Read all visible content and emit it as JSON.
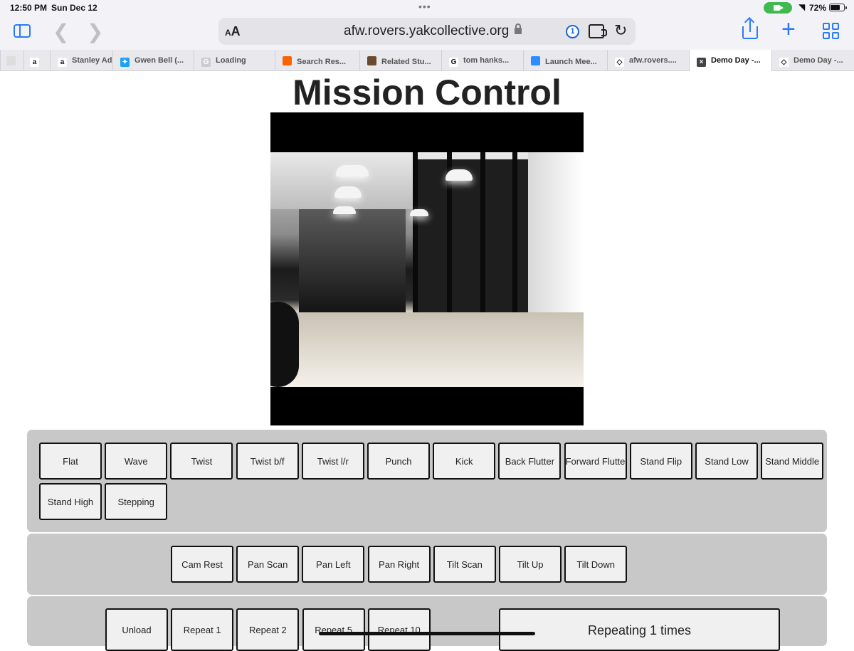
{
  "status_bar": {
    "time": "12:50 PM",
    "date": "Sun Dec 12",
    "battery": "72%",
    "battery_level": 0.72
  },
  "toolbar": {
    "text_size_label": "AA",
    "url": "afw.rovers.yakcollective.org"
  },
  "tabs": [
    {
      "label": "",
      "icon": "page-icon"
    },
    {
      "label": "",
      "icon": "amazon-icon"
    },
    {
      "label": "Stanley Ad",
      "icon": "amazon-icon"
    },
    {
      "label": "Gwen Bell (...",
      "icon": "twitter-icon"
    },
    {
      "label": "Loading",
      "icon": "g-icon"
    },
    {
      "label": "Search Res...",
      "icon": "home-depot-icon"
    },
    {
      "label": "Related Stu...",
      "icon": "book-icon"
    },
    {
      "label": "tom hanks...",
      "icon": "google-icon"
    },
    {
      "label": "Launch Mee...",
      "icon": "zoom-icon"
    },
    {
      "label": "afw.rovers....",
      "icon": "yak-icon"
    },
    {
      "label": "Demo Day -...",
      "icon": "close-icon",
      "active": true
    },
    {
      "label": "Demo Day -...",
      "icon": "yak-icon"
    }
  ],
  "page": {
    "title": "Mission Control"
  },
  "motion_buttons": [
    "Flat",
    "Wave",
    "Twist",
    "Twist b/f",
    "Twist l/r",
    "Punch",
    "Kick",
    "Back Flutter",
    "Forward Flutter",
    "Stand Flip",
    "Stand Low",
    "Stand Middle",
    "Stand High",
    "Stepping"
  ],
  "camera_buttons": [
    "Cam Rest",
    "Pan Scan",
    "Pan Left",
    "Pan Right",
    "Tilt Scan",
    "Tilt Up",
    "Tilt Down"
  ],
  "repeat_buttons": [
    "Unload",
    "Repeat 1",
    "Repeat 2",
    "Repeat 5",
    "Repeat 10"
  ],
  "repeat_status": "Repeating 1 times"
}
